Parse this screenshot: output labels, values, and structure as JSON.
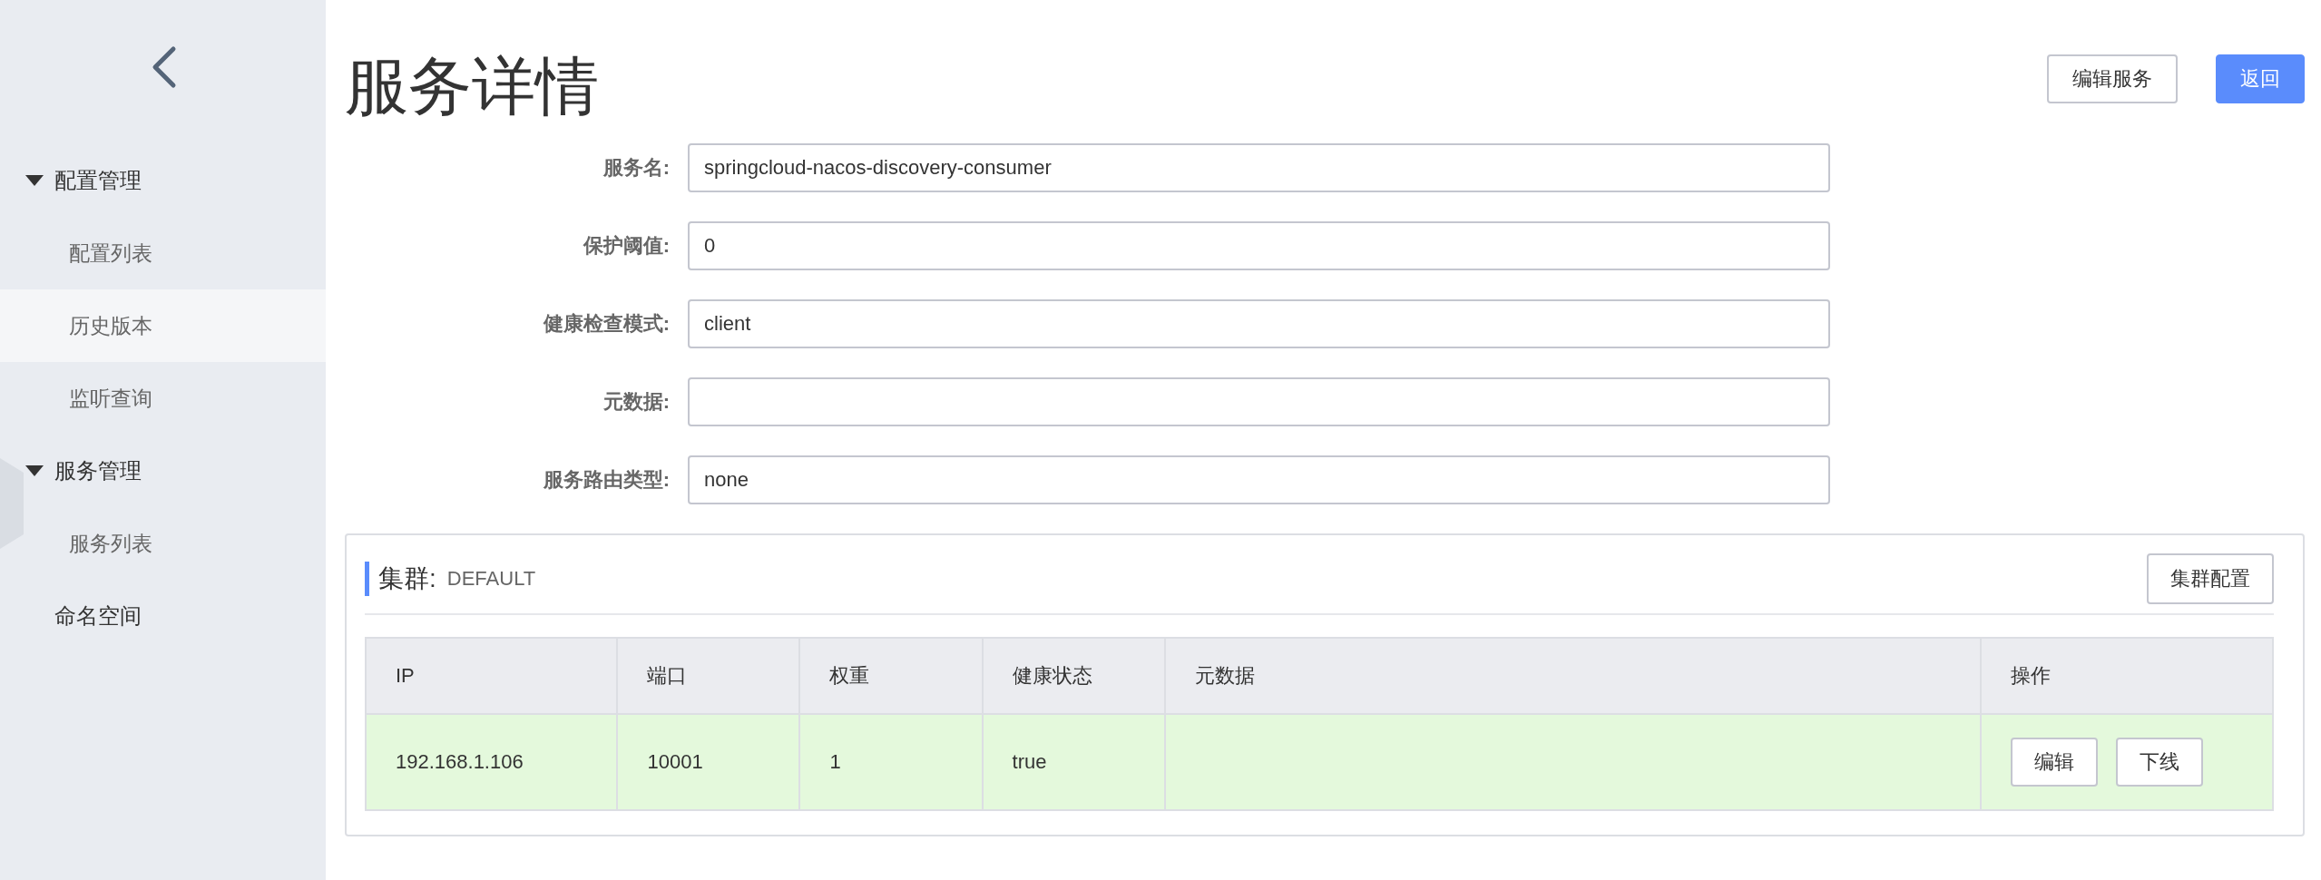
{
  "sidebar": {
    "items": [
      {
        "label": "配置管理",
        "expanded": true,
        "children": [
          {
            "label": "配置列表",
            "selected": false
          },
          {
            "label": "历史版本",
            "selected": true
          },
          {
            "label": "监听查询",
            "selected": false
          }
        ]
      },
      {
        "label": "服务管理",
        "expanded": true,
        "children": [
          {
            "label": "服务列表",
            "selected": false
          }
        ]
      },
      {
        "label": "命名空间"
      }
    ]
  },
  "page": {
    "title": "服务详情",
    "buttons": [
      {
        "label": "编辑服务",
        "kind": "default"
      },
      {
        "label": "返回",
        "kind": "primary"
      }
    ]
  },
  "form": [
    {
      "label": "服务名:",
      "value": "springcloud-nacos-discovery-consumer"
    },
    {
      "label": "保护阈值:",
      "value": "0"
    },
    {
      "label": "健康检查模式:",
      "value": "client"
    },
    {
      "label": "元数据:"
    },
    {
      "label": "服务路由类型:",
      "value": "none"
    }
  ],
  "cluster": {
    "label": "集群:",
    "name": "DEFAULT",
    "button": "集群配置",
    "table": {
      "columns": [
        "IP",
        "端口",
        "权重",
        "健康状态",
        "元数据",
        "操作"
      ],
      "rows": [
        {
          "healthy": true,
          "cells": [
            "192.168.1.106",
            "10001",
            "1",
            "true",
            null
          ],
          "actions": [
            "编辑",
            "下线"
          ]
        }
      ]
    }
  }
}
